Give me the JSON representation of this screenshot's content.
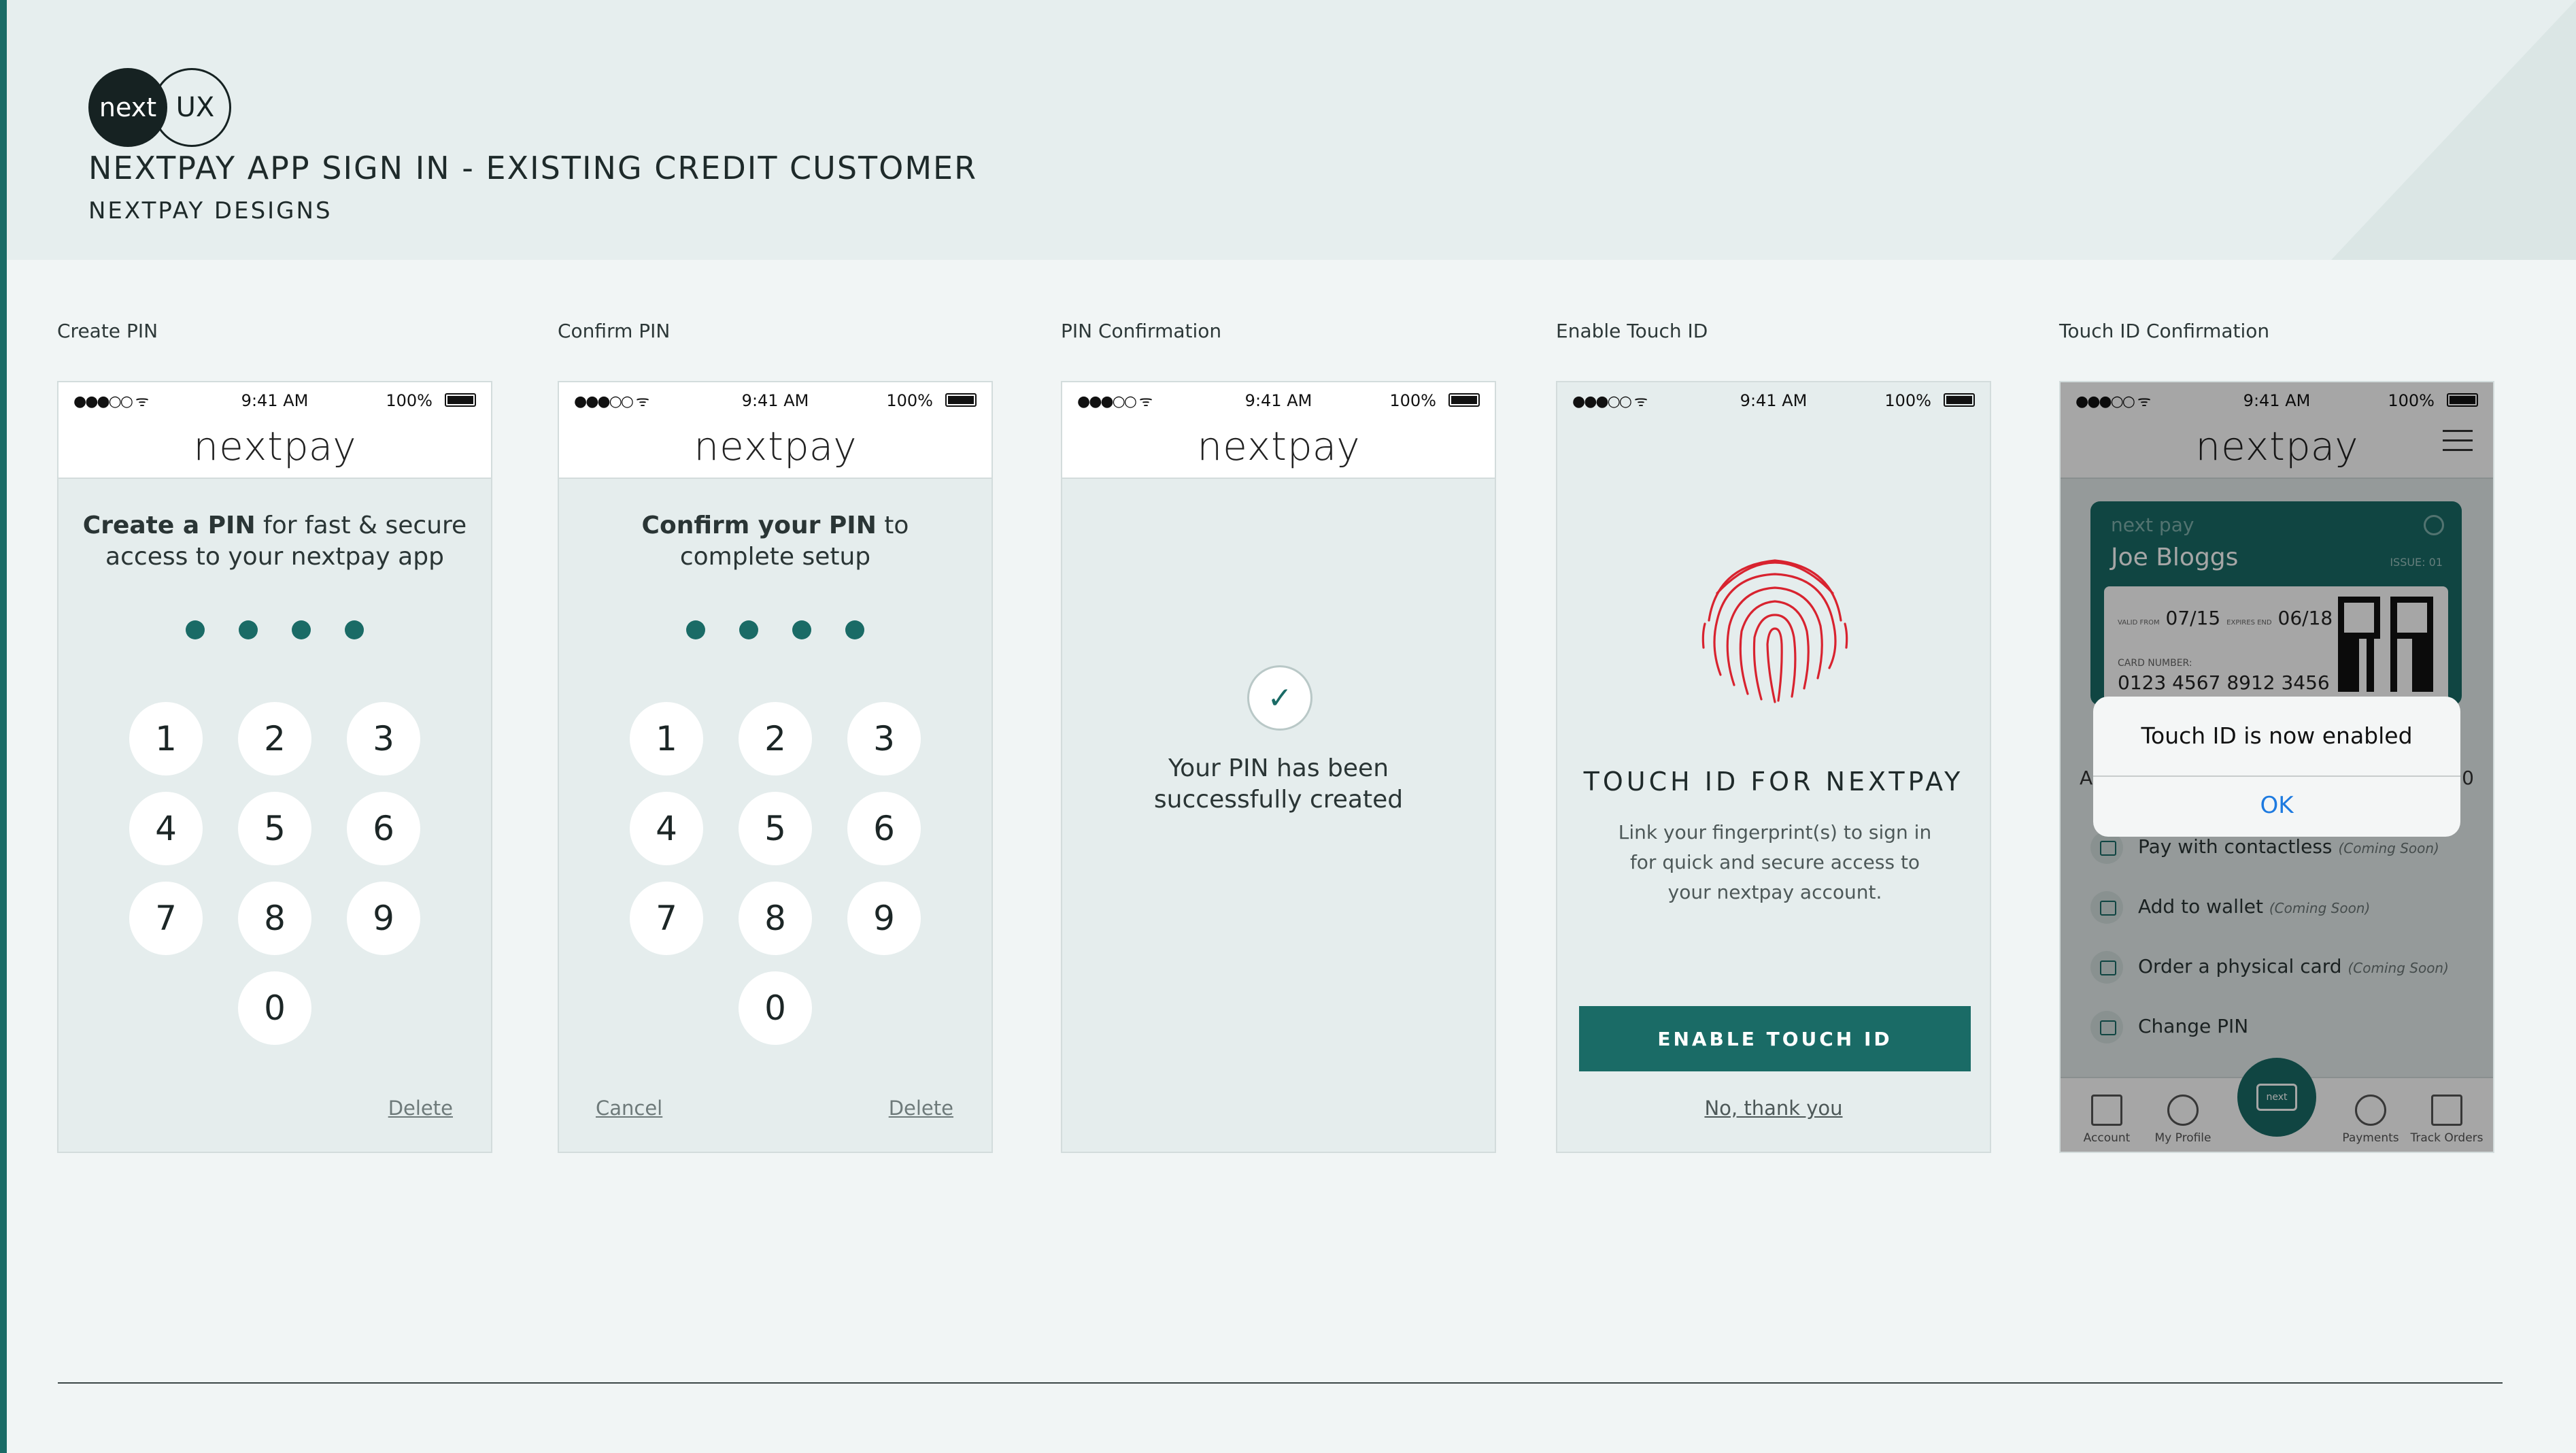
{
  "header": {
    "logo_left": "next",
    "logo_right": "UX",
    "title": "NEXTPAY APP SIGN IN - EXISTING CREDIT CUSTOMER",
    "subtitle": "NEXTPAY DESIGNS"
  },
  "status": {
    "time": "9:41 AM",
    "battery": "100%"
  },
  "brand": {
    "part1": "next",
    "part2": "pay"
  },
  "screens": {
    "create": {
      "label": "Create PIN",
      "prompt_bold": "Create a PIN",
      "prompt_rest": " for fast & secure access to your nextpay app",
      "delete": "Delete"
    },
    "confirm": {
      "label": "Confirm PIN",
      "prompt_bold": "Confirm your PIN",
      "prompt_rest": " to complete setup",
      "cancel": "Cancel",
      "delete": "Delete"
    },
    "pin_confirmation": {
      "label": "PIN Confirmation",
      "message": "Your PIN has been successfully created",
      "check": "✓"
    },
    "enable_touch": {
      "label": "Enable Touch ID",
      "heading": "TOUCH ID FOR NEXTPAY",
      "body": "Link your fingerprint(s) to sign in for quick and secure access to your nextpay account.",
      "button": "ENABLE TOUCH ID",
      "no_thanks": "No, thank you"
    },
    "touch_confirmation": {
      "label": "Touch ID Confirmation",
      "card": {
        "brand": "next pay",
        "holder": "Joe Bloggs",
        "issue": "ISSUE: 01",
        "valid_from_label": "VALID FROM",
        "valid_from": "07/15",
        "expires_label": "EXPIRES END",
        "expires": "06/18",
        "card_number_label": "CARD NUMBER:",
        "card_number": "0123 4567 8912 3456"
      },
      "menu": [
        {
          "label": "Pay with contactless",
          "note": "(Coming Soon)"
        },
        {
          "label": "Add to wallet",
          "note": "(Coming Soon)"
        },
        {
          "label": "Order a physical card",
          "note": "(Coming Soon)"
        },
        {
          "label": "Change PIN",
          "note": ""
        }
      ],
      "tabs": [
        "Account",
        "My Profile",
        "Payments",
        "Track Orders"
      ],
      "center_tab": "next",
      "edge_left": "A",
      "edge_right": "0",
      "alert": {
        "message": "Touch ID is now enabled",
        "ok": "OK"
      }
    }
  },
  "keypad": [
    "1",
    "2",
    "3",
    "4",
    "5",
    "6",
    "7",
    "8",
    "9",
    "0"
  ],
  "colors": {
    "primary": "#1a6b66",
    "alert_link": "#1d7ae0",
    "fingerprint": "#d8232f"
  }
}
